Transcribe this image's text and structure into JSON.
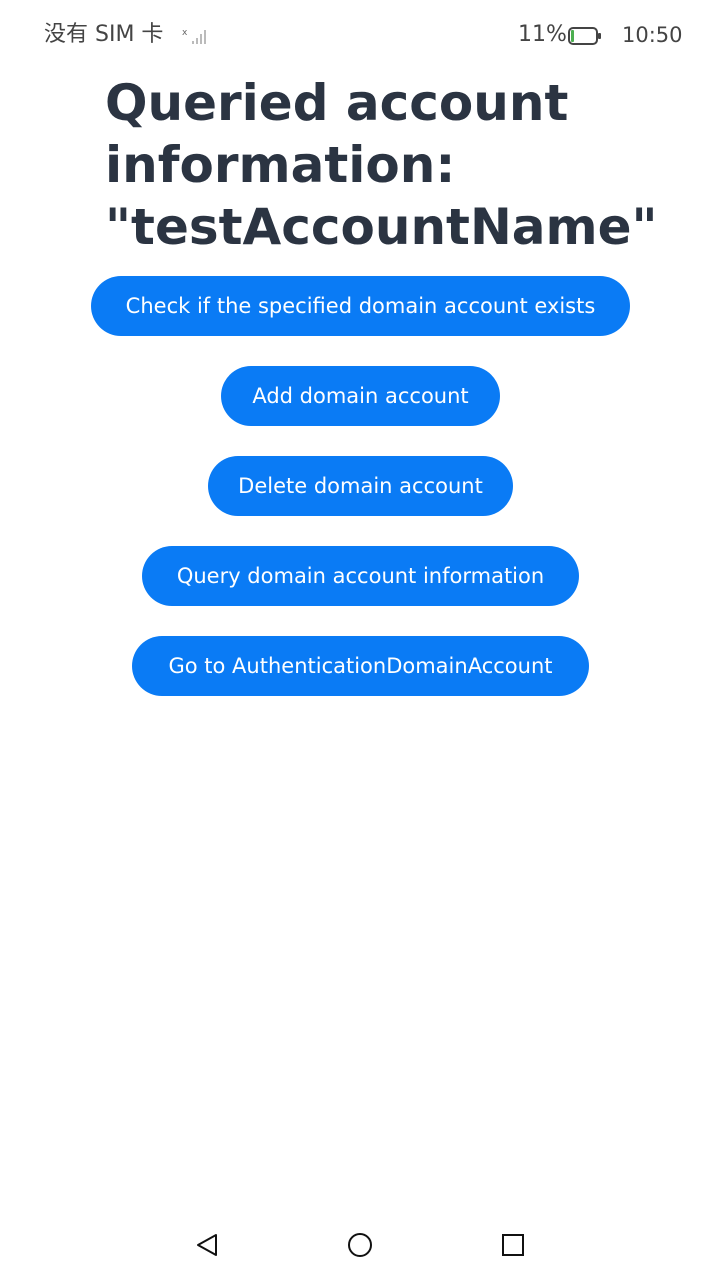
{
  "status_bar": {
    "carrier": "没有 SIM 卡",
    "battery_percent": "11%",
    "time": "10:50"
  },
  "title": "Queried account\ninformation:\n\"testAccountName\"",
  "buttons": {
    "check_exists": "Check if the specified domain account exists",
    "add": "Add domain account",
    "delete": "Delete domain account",
    "query": "Query domain account information",
    "goto_auth": "Go to AuthenticationDomainAccount"
  },
  "colors": {
    "button_bg": "#0a7bf5",
    "title_text": "#2b3442",
    "battery_level": "#4caf50"
  },
  "icons": {
    "signal": "signal-icon",
    "battery": "battery-icon",
    "nav_back": "back-triangle-icon",
    "nav_home": "home-circle-icon",
    "nav_recent": "recent-square-icon"
  }
}
